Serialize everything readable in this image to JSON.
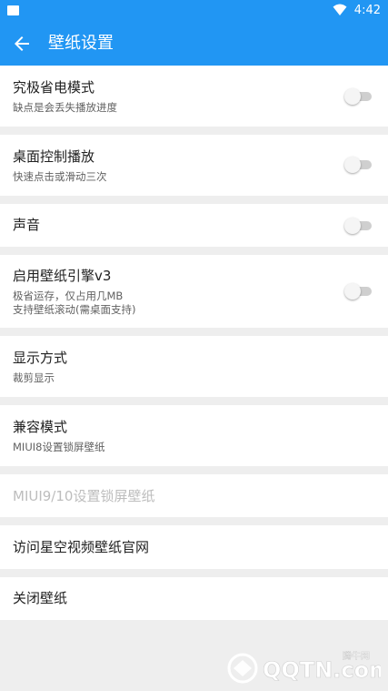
{
  "status_bar": {
    "time": "4:42"
  },
  "app_bar": {
    "title": "壁纸设置"
  },
  "settings": [
    {
      "title": "究极省电模式",
      "line1": "缺点是会丢失播放进度",
      "line2": "",
      "switch_on": false
    },
    {
      "title": "桌面控制播放",
      "line1": "快速点击或滑动三次",
      "line2": "",
      "switch_on": false
    },
    {
      "title": "声音",
      "line1": "",
      "line2": "",
      "switch_on": false
    },
    {
      "title": "启用壁纸引擎v3",
      "line1": "极省运存，仅占用几MB",
      "line2": "支持壁纸滚动(需桌面支持)",
      "switch_on": false
    },
    {
      "title": "显示方式",
      "line1": "裁剪显示",
      "line2": ""
    },
    {
      "title": "兼容模式",
      "line1": "MIUI8设置锁屏壁纸",
      "line2": ""
    },
    {
      "title": "MIUI9/10设置锁屏壁纸",
      "line1": "",
      "line2": "",
      "disabled": true
    },
    {
      "title": "访问星空视频壁纸官网",
      "line1": "",
      "line2": ""
    },
    {
      "title": "关闭壁纸",
      "line1": "",
      "line2": ""
    }
  ],
  "watermark": {
    "text": "QQTN.com",
    "subtext": "腾牛网"
  },
  "colors": {
    "primary": "#2196f3",
    "background": "#eeeeee",
    "switch_off_track": "#cfcfcf"
  }
}
